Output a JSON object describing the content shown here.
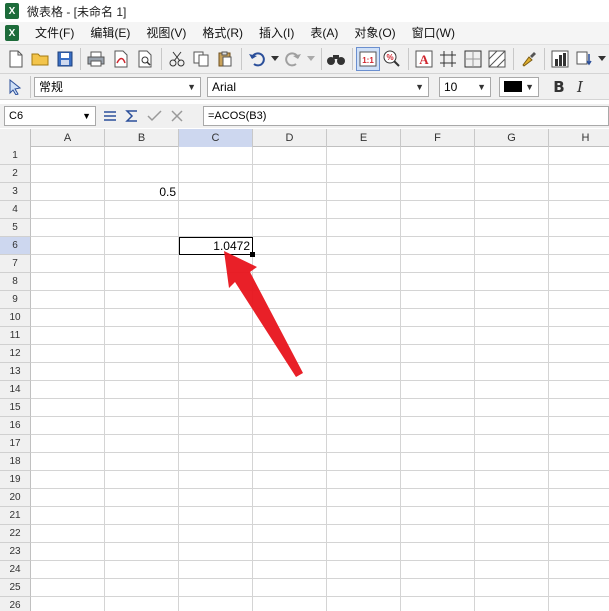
{
  "window": {
    "title": "微表格 - [未命名 1]",
    "app_icon": "X"
  },
  "menu": {
    "items": [
      "文件(F)",
      "编辑(E)",
      "视图(V)",
      "格式(R)",
      "插入(I)",
      "表(A)",
      "对象(O)",
      "窗口(W)"
    ]
  },
  "format_bar": {
    "style": "常规",
    "font": "Arial",
    "size": "10",
    "bold_label": "B",
    "italic_label": "I"
  },
  "formula_bar": {
    "cell_ref": "C6",
    "formula": "=ACOS(B3)"
  },
  "sheet": {
    "columns": [
      "A",
      "B",
      "C",
      "D",
      "E",
      "F",
      "G",
      "H"
    ],
    "rows": [
      "1",
      "2",
      "3",
      "4",
      "5",
      "6",
      "7",
      "8",
      "9",
      "10",
      "11",
      "12",
      "13",
      "14",
      "15",
      "16",
      "17",
      "18",
      "19",
      "20",
      "21",
      "22",
      "23",
      "24",
      "25",
      "26"
    ],
    "active_column": "C",
    "active_row": "6",
    "cell_b3": "0.5",
    "cell_c6": "1.0472"
  },
  "colors": {
    "accent": "#cdd7ef",
    "arrow": "#e8141c",
    "app_icon": "#1d6b3a"
  }
}
